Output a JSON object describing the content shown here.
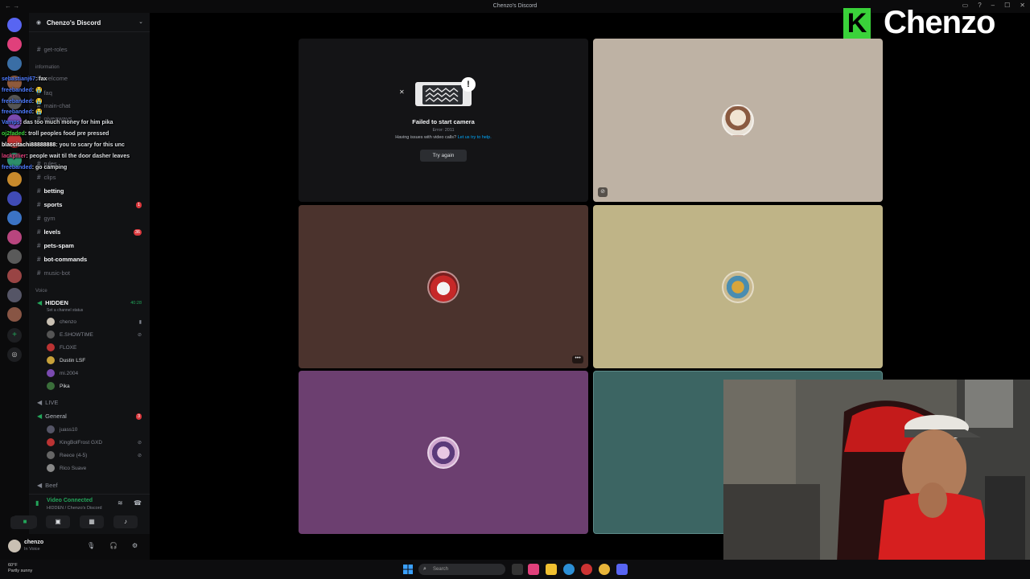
{
  "window": {
    "title": "Chenzo's Discord"
  },
  "server": {
    "name": "Chenzo's Discord"
  },
  "channels": {
    "get_roles": "get-roles",
    "cat_information": "information",
    "welcome": "welcome",
    "faq": "faq",
    "main_chat": "main-chat",
    "giveaways": "giveaways",
    "rules": "rules",
    "clips": "clips",
    "betting": "betting",
    "betting_channel": "betting",
    "sports": "sports",
    "sports_badge": "1",
    "gym": "gym",
    "levels": "levels",
    "levels_badge": "36",
    "pets_spam": "pets-spam",
    "bot_commands": "bot-commands",
    "music_bot": "music-bot",
    "cat_voice": "Voice"
  },
  "voice": {
    "hidden_channel": "HIDDEN",
    "hidden_timer": "40:28",
    "hidden_status": "Set a channel status",
    "hidden_users": [
      "chenzo",
      "E.SHOWTIME",
      "FLOXE",
      "Dustin",
      "mi.2004",
      "Pika"
    ],
    "dustin_tag": "LSF",
    "live_channel": "LIVE",
    "general_channel": "General",
    "general_badge": "3",
    "general_users": [
      "juass10",
      "KingBolFrost",
      "Reece (4-5)",
      "Rico Suave"
    ],
    "kingbol_tag": "GXD",
    "beef_channel": "Beef"
  },
  "voice_panel": {
    "status": "Video Connected",
    "sub": "HIDDEN / Chenzo's Discord"
  },
  "user_panel": {
    "name": "chenzo",
    "status": "In Voice"
  },
  "chat_overlay": [
    {
      "user": "sebastianj67",
      "text": ": fax",
      "color": "#4f7cff"
    },
    {
      "user": "freebanded",
      "text": ": 😭",
      "color": "#4f7cff"
    },
    {
      "user": "freebanded",
      "text": ": 😭",
      "color": "#4f7cff"
    },
    {
      "user": "freebanded",
      "text": ": 😭",
      "color": "#4f7cff"
    },
    {
      "user": "Vamps",
      "text": ": das too much money for him pika",
      "color": "#4f7cff"
    },
    {
      "user": "oj2faded",
      "text": ": troll peoples food pre pressed",
      "color": "#3ad23a"
    },
    {
      "user": "blaccitachi88888888",
      "text": ": you to scary for this unc",
      "color": "#ffffff"
    },
    {
      "user": "lackpilier",
      "text": ": people wait til the door dasher leaves",
      "color": "#e0407b"
    },
    {
      "user": "freebanded",
      "text": ": go camping",
      "color": "#4f7cff"
    }
  ],
  "camera_error": {
    "title": "Failed to start camera",
    "error": "Error: 2011",
    "help": "Having issues with video calls?",
    "help_link": "Let us try to help.",
    "button": "Try again"
  },
  "tiles_colors": {
    "self": "#141416",
    "t2": "#beb2a4",
    "t3": "#4b332d",
    "t4": "#bfb487",
    "t5": "#6c3f70",
    "t6": "#3c6563"
  },
  "logo": {
    "text": "Chenzo",
    "mark": "K",
    "color": "#3ad23a"
  },
  "taskbar": {
    "weather": "60°F",
    "weather_sub": "Partly sunny",
    "search_placeholder": "Search"
  }
}
